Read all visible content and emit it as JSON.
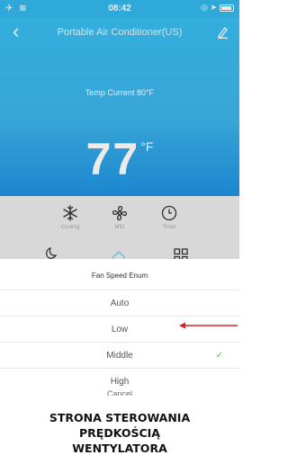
{
  "status_bar": {
    "left_icons": "✈ ≋",
    "time": "08:42",
    "right_icons": "◎ ➤"
  },
  "nav": {
    "back_icon": "chevron-left-icon",
    "title": "Portable Air Conditioner(US)",
    "edit_icon": "pencil-icon"
  },
  "hero": {
    "temp_current": "Temp Current  80°F",
    "temp_set": "77",
    "temp_unit": "°F"
  },
  "controls": [
    {
      "icon": "snowflake-icon",
      "label": "Cooling"
    },
    {
      "icon": "fan-icon",
      "label": "MID"
    },
    {
      "icon": "clock-icon",
      "label": "Timer"
    }
  ],
  "sheet": {
    "title": "Fan Speed Enum",
    "options": [
      "Auto",
      "Low",
      "Middle",
      "High"
    ],
    "selected": "Middle",
    "cancel": "Cancel"
  },
  "colors": {
    "accent": "#38bdf0",
    "check": "#4cc14a",
    "arrow": "#e01b24"
  },
  "caption": {
    "line1": "STRONA STEROWANIA",
    "line2": "PRĘDKOŚCIĄ",
    "line3": "WENTYLATORA"
  }
}
